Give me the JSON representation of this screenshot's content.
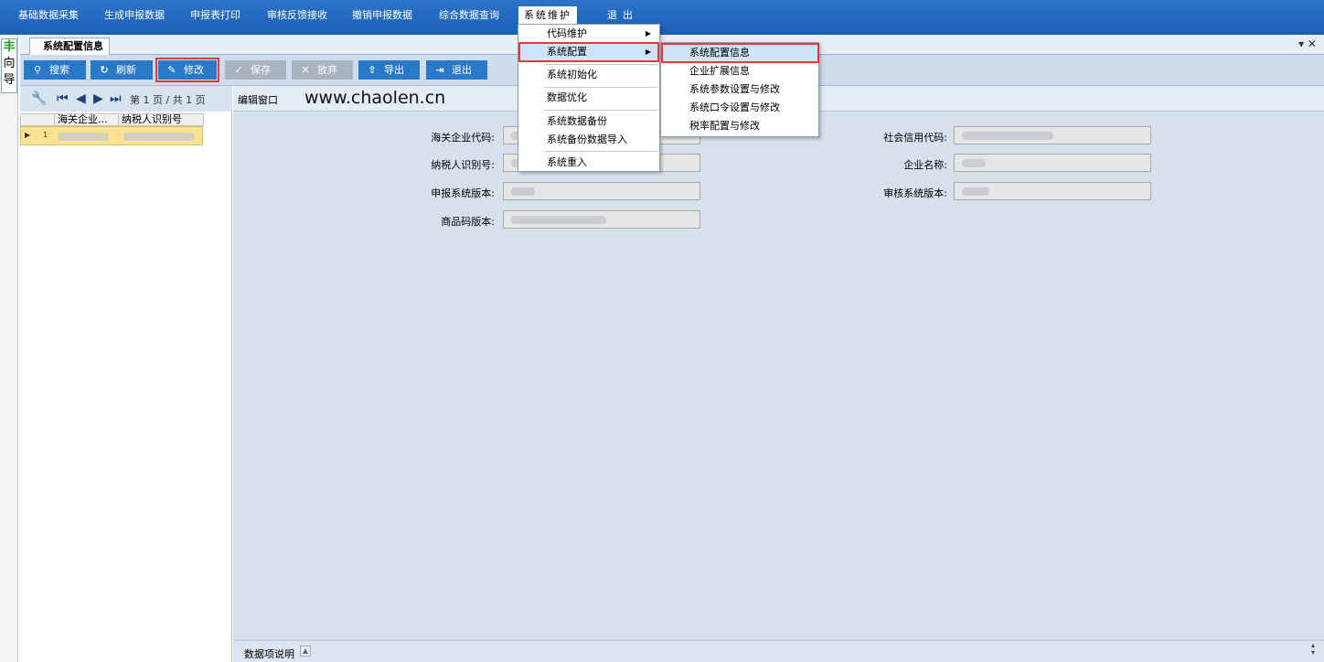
{
  "menubar": {
    "items": [
      "基础数据采集",
      "生成申报数据",
      "申报表打印",
      "审核反馈接收",
      "撤销申报数据",
      "综合数据查询",
      "系统维护",
      "退出"
    ]
  },
  "leftstrip": {
    "chars": [
      "向",
      "导"
    ]
  },
  "tab": {
    "title": "系统配置信息",
    "controls": "▾ ✕"
  },
  "toolbar": {
    "search": "搜索",
    "refresh": "刷新",
    "edit": "修改",
    "save": "保存",
    "discard": "放弃",
    "export": "导出",
    "exit": "退出"
  },
  "pager": {
    "text": "第 1 页 / 共 1 页"
  },
  "grid": {
    "columns": [
      "海关企业...",
      "纳税人识别号"
    ],
    "rows": [
      {
        "index": "1"
      }
    ]
  },
  "editwin": {
    "title": "编辑窗口",
    "watermark": "www.chaolen.cn",
    "fields": {
      "customs_code": "海关企业代码:",
      "taxpayer_id": "纳税人识别号:",
      "declare_version": "申报系统版本:",
      "goods_code_version": "商品码版本:",
      "social_credit": "社会信用代码:",
      "company_name": "企业名称:",
      "audit_version": "审核系统版本:"
    },
    "footer": "数据项说明"
  },
  "menu_main": {
    "items": [
      "代码维护",
      "系统配置",
      "系统初始化",
      "数据优化",
      "系统数据备份",
      "系统备份数据导入",
      "系统重入"
    ]
  },
  "menu_sub": {
    "items": [
      "系统配置信息",
      "企业扩展信息",
      "系统参数设置与修改",
      "系统口令设置与修改",
      "税率配置与修改"
    ]
  },
  "colors": {
    "menubar": "#1f66bd",
    "button": "#2a78c8",
    "highlight": "#e03a3a",
    "selected_row": "#fbe38f"
  }
}
